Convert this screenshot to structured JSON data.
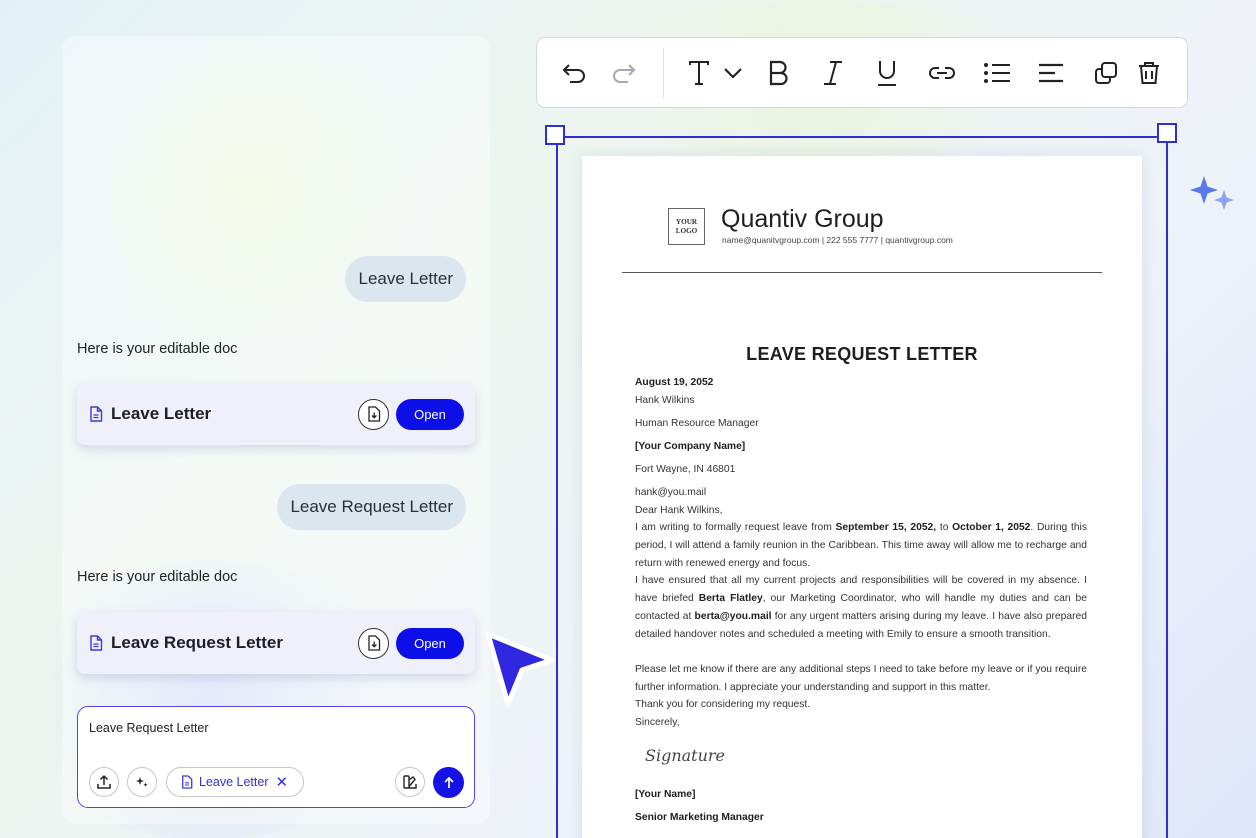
{
  "chat": {
    "messages": [
      {
        "user": "Leave Letter",
        "reply": "Here is your editable doc",
        "doc_title": "Leave Letter",
        "open_label": "Open"
      },
      {
        "user": "Leave Request Letter",
        "reply": "Here is your editable doc",
        "doc_title": "Leave Request Letter",
        "open_label": "Open"
      }
    ],
    "input": {
      "text": "Leave Request Letter",
      "chip_label": "Leave Letter",
      "chip_close": "✕"
    }
  },
  "toolbar": {
    "tools": [
      "undo-icon",
      "redo-icon",
      "text-style-icon",
      "chevron-down-icon",
      "bold-icon",
      "italic-icon",
      "underline-icon",
      "link-icon",
      "bullet-list-icon",
      "align-left-icon",
      "duplicate-icon",
      "delete-icon"
    ]
  },
  "document": {
    "logo_line1": "YOUR",
    "logo_line2": "LOGO",
    "company": "Quantiv Group",
    "company_contact": "name@quanitvgroup.com | 222 555 7777 | quantivgroup.com",
    "title": "LEAVE REQUEST LETTER",
    "date": "August 19, 2052",
    "recipient_name": "Hank Wilkins",
    "recipient_role": "Human Resource Manager",
    "recipient_company": "[Your Company Name]",
    "recipient_city": "Fort Wayne, IN 46801",
    "recipient_email": "hank@you.mail",
    "salutation": "Dear Hank Wilkins,",
    "p1": {
      "a": "I am writing to formally request leave from ",
      "start": "September 15, 2052,",
      "b": " to ",
      "end": "October 1, 2052",
      "c": ". During this period, I will attend a family reunion in the Caribbean. This time away will allow me to recharge and return with renewed energy and focus."
    },
    "p2": {
      "a": "I have ensured that all my current projects and responsibilities will be covered in my absence. I have briefed ",
      "name": "Berta Flatley",
      "b": ", our Marketing Coordinator, who will handle my duties and can be contacted at ",
      "email": "berta@you.mail",
      "c": " for any urgent matters arising during my leave. I have also prepared detailed handover notes and scheduled a meeting with Emily to ensure a smooth transition."
    },
    "p3": "Please let me know if there are any additional steps I need to take before my leave or if you require further information. I appreciate your understanding and support in this matter.",
    "thanks": "Thank you for considering my request.",
    "closing": "Sincerely,",
    "signature": "Signature",
    "sender_name": "[Your Name]",
    "sender_role": "Senior Marketing Manager"
  },
  "colors": {
    "accent": "#0d0fe8",
    "frame": "#2c2fd6",
    "bubble": "#dbe6ef",
    "card": "#eff0fa"
  }
}
